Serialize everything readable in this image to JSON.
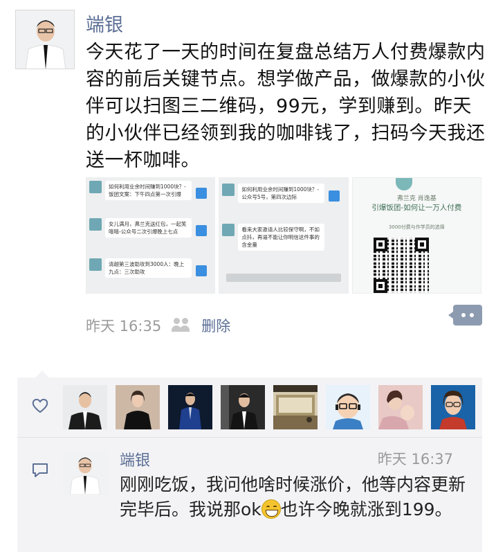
{
  "post": {
    "author": "端银",
    "text": "今天花了一天的时间在复盘总结万人付费爆款内容的前后关键节点。想学做产品，做爆款的小伙伴可以扫图三二维码，99元，学到赚到。昨天的小伙伴已经领到我的咖啡钱了，扫码今天我还送一杯咖啡。",
    "time": "昨天 16:35",
    "delete_label": "删除",
    "images": [
      {
        "messages": [
          {
            "text": "如何利用业余时间赚到1000块？-饭团文案：下午四点第一次引爆"
          },
          {
            "text": "女儿满月，弗兰克送红包，一起笑嘻嘻-公众号二次引爆晚上七点"
          },
          {
            "text": "清越第三波助攻到3000人：晚上九点：三次助攻"
          }
        ]
      },
      {
        "messages": [
          {
            "text": "如何利用业余时间赚到1000块？-公众号5号，第四次边际"
          },
          {
            "text": "看来大家邀请人比较保守啊，不如点抖，再逼不能让你明信这件事的含金量"
          }
        ]
      },
      {
        "share_name": "弗兰克 肖逸基",
        "share_title": "引爆饭团-如何让一万人付费",
        "share_sub": "3000付费与作学员的选择"
      }
    ]
  },
  "more_icon": "more-dots-icon",
  "likes": {
    "icon": "heart-icon",
    "avatars": [
      "avatar-man-suit",
      "avatar-woman-black",
      "avatar-man-blue-suit",
      "avatar-man-dark-suit",
      "avatar-room-photo",
      "avatar-cartoon-glasses",
      "avatar-mother-baby",
      "avatar-woman-glasses"
    ]
  },
  "comment": {
    "icon": "comment-icon",
    "author": "端银",
    "time": "昨天 16:37",
    "text_before": "刚刚吃饭，我问他啥时候涨价，他等内容更新完毕后。我说那ok",
    "emoji": "grin-emoji",
    "text_after": "也许今晚就涨到199。"
  }
}
